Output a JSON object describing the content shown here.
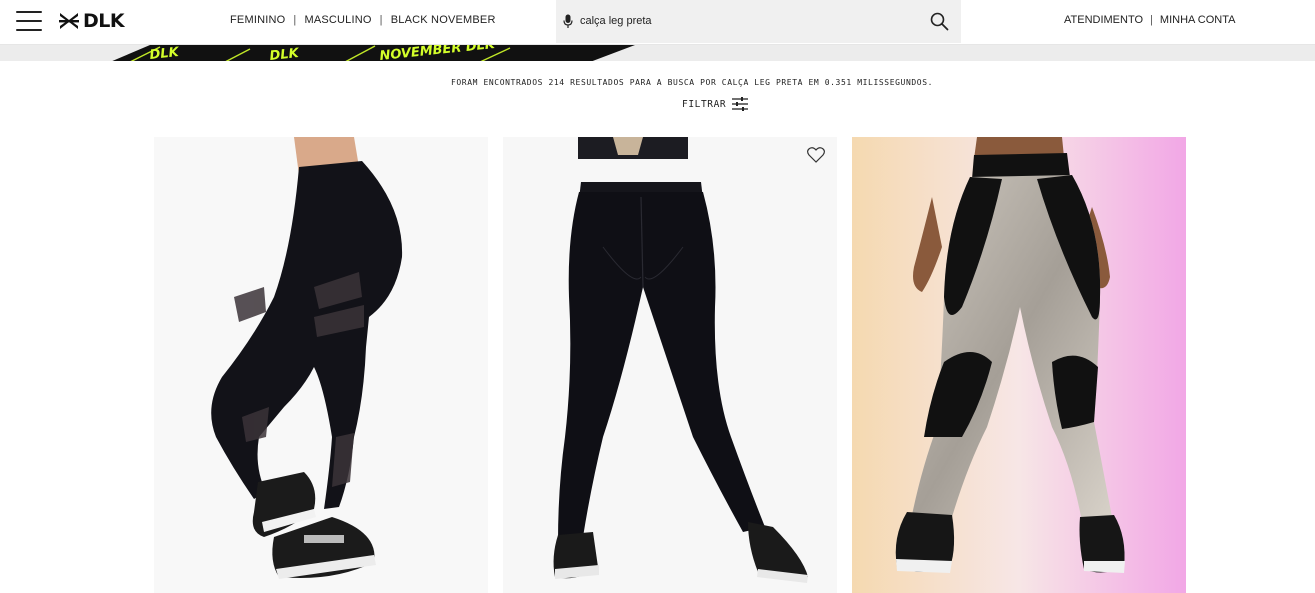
{
  "header": {
    "logo_text": "DLK",
    "nav": [
      "FEMININO",
      "MASCULINO",
      "BLACK NOVEMBER"
    ],
    "separator": "|",
    "search": {
      "value": "calça leg preta",
      "placeholder": "calça leg preta"
    },
    "account_links": [
      "ATENDIMENTO",
      "MINHA CONTA"
    ]
  },
  "results": {
    "summary": "FORAM ENCONTRADOS 214 RESULTADOS PARA A BUSCA POR CALÇA LEG PRETA EM 0.351 MILISSEGUNDOS.",
    "filter_label": "FILTRAR"
  },
  "colors": {
    "banner_text": "#d4ff2a",
    "banner_bg": "#111111",
    "search_bg": "#f0f0f0"
  },
  "icons": {
    "menu": "hamburger-icon",
    "mic": "microphone-icon",
    "search": "magnifier-icon",
    "filter": "sliders-icon",
    "wishlist": "heart-icon"
  }
}
